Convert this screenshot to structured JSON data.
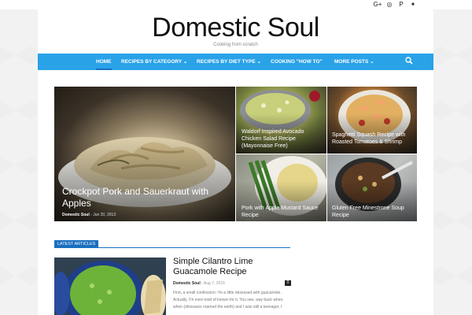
{
  "topbar": {
    "social": [
      {
        "name": "google-plus-icon",
        "glyph": "G+"
      },
      {
        "name": "instagram-icon",
        "glyph": "◎"
      },
      {
        "name": "pinterest-icon",
        "glyph": "P"
      },
      {
        "name": "twitter-icon",
        "glyph": "✦"
      }
    ]
  },
  "header": {
    "title": "Domestic Soul",
    "tagline": "Cooking from scratch"
  },
  "nav": {
    "items": [
      {
        "label": "HOME",
        "active": true
      },
      {
        "label": "RECIPES BY CATEGORY ⌄"
      },
      {
        "label": "RECIPES BY DIET TYPE ⌄"
      },
      {
        "label": "COOKING \"HOW TO\""
      },
      {
        "label": "MORE POSTS ⌄"
      }
    ],
    "search_icon": "search-icon"
  },
  "featured": {
    "big": {
      "title": "Crockpot Pork and Sauerkraut with Apples",
      "author": "Domestic Soul",
      "separator": " - ",
      "date": "Jun 20, 2013"
    },
    "tiles": [
      {
        "title": "Waldorf Inspired Avocado Chicken Salad Recipe (Mayonnaise Free)"
      },
      {
        "title": "Spaghetti Squash Recipe with Roasted Tomatoes & Shrimp"
      },
      {
        "title": "Pork with Apple Mustard Sauce Recipe"
      },
      {
        "title": "Gluten Free Minestrone Soup Recipe"
      }
    ]
  },
  "latest": {
    "label": "LATEST ARTICLES",
    "article": {
      "title": "Simple Cilantro Lime Guacamole Recipe",
      "author": "Domestic Soul",
      "separator": " - ",
      "date": "Aug 7, 2016",
      "comments": "0",
      "excerpt": "First, a small confession: I'm a little obsessed with guacamole. Actually, I'm even kind of known for it. You see, way back when, when (dinosaurs roamed the earth) and I was still a teenager, I"
    }
  },
  "colors": {
    "nav_bg": "#29a2e8",
    "accent": "#1a6fc0"
  }
}
